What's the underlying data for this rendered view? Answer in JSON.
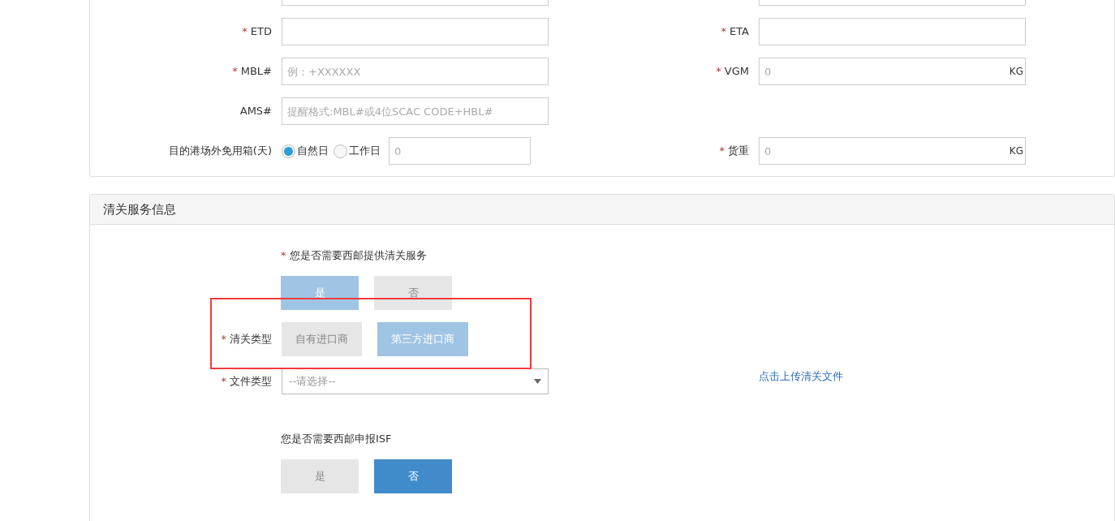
{
  "shipment_section": {
    "rows": [
      {
        "left": {
          "kind": "text"
        },
        "right": {
          "kind": "text"
        }
      },
      {
        "left": {
          "kind": "text",
          "label": "ETD",
          "required_mark": "*"
        },
        "right": {
          "kind": "text",
          "label": "ETA",
          "required_mark": "*"
        }
      },
      {
        "left": {
          "kind": "text",
          "label": "MBL#",
          "required_mark": "*",
          "placeholder": "例：+XXXXXX"
        },
        "right": {
          "kind": "unit",
          "label": "VGM",
          "required_mark": "*",
          "placeholder": "0",
          "unit": "KG"
        }
      },
      {
        "left": {
          "kind": "text",
          "label": "AMS#",
          "placeholder": "提醒格式:MBL#或4位SCAC CODE+HBL#"
        }
      },
      {
        "left": {
          "kind": "radio",
          "label": "目的港场外免用箱(天)",
          "options": [
            {
              "label": "自然日",
              "selected": true
            },
            {
              "label": "工作日",
              "selected": false
            }
          ],
          "placeholder": "0"
        },
        "right": {
          "kind": "unit",
          "label": "货重",
          "required_mark": "*",
          "placeholder": "0",
          "unit": "KG"
        }
      }
    ]
  },
  "customs_section": {
    "title": "清关服务信息",
    "items": [
      {
        "kind": "question",
        "text": "您是否需要西邮提供清关服务",
        "required_mark": "*",
        "disabled": true,
        "options": [
          {
            "label": "是",
            "selected": true
          },
          {
            "label": "否",
            "selected": false
          }
        ]
      },
      {
        "kind": "labeled",
        "label": "清关类型",
        "required_mark": "*",
        "disabled": true,
        "highlighted": true,
        "options": [
          {
            "label": "自有进口商",
            "selected": false
          },
          {
            "label": "第三方进口商",
            "selected": true
          }
        ]
      },
      {
        "kind": "select",
        "label": "文件类型",
        "required_mark": "*",
        "placeholder": "--请选择--",
        "link": "点击上传清关文件"
      },
      {
        "kind": "question",
        "text": "您是否需要西邮申报ISF",
        "disabled": false,
        "options": [
          {
            "label": "是",
            "selected": false
          },
          {
            "label": "否",
            "selected": true
          }
        ]
      }
    ]
  }
}
